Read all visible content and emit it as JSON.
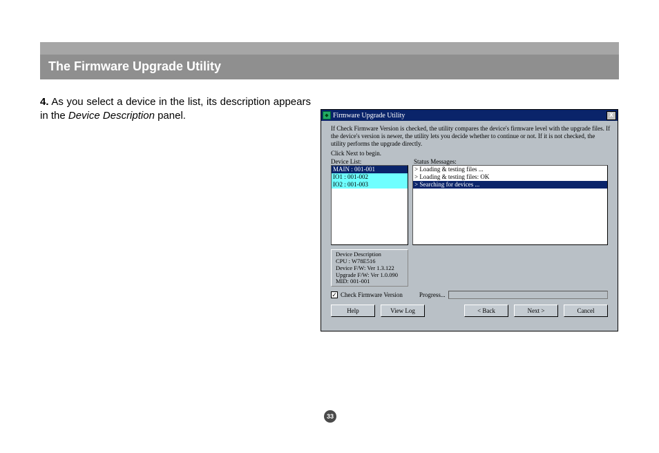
{
  "banner": {
    "title": "The Firmware Upgrade Utility"
  },
  "body": {
    "step_num": "4.",
    "text_a": " As you select a device in the list, its descrip­tion appears in the ",
    "ital": "Device Description",
    "text_b": " panel."
  },
  "page_number": "33",
  "dialog": {
    "title": "Firmware Upgrade Utility",
    "close": "x",
    "instructions": "If Check Firmware Version is checked, the utility compares the device's firmware level with the upgrade files. If the device's version is newer, the utility lets you decide whether to continue or not. If it is not checked, the utility performs the upgrade directly.",
    "click_next": "Click Next to begin.",
    "device_list_label": "Device List:",
    "status_label": "Status Messages:",
    "device_list": {
      "i0": "MAIN : 001-001",
      "i1": "IO1 : 001-002",
      "i2": "IO2 : 001-003"
    },
    "status": {
      "s0": "> Loading & testing files ...",
      "s1": "> Loading & testing files: OK",
      "s2": "> Searching for devices ..."
    },
    "desc": {
      "l0": "Device Description",
      "l1": "CPU : W78E516",
      "l2": "Device F/W: Ver 1.3.122",
      "l3": "Upgrade F/W: Ver 1.0.090",
      "l4": "MID: 001-001"
    },
    "check_label": "Check Firmware Version",
    "check_mark": "✓",
    "progress_label": "Progress...",
    "buttons": {
      "help": "Help",
      "viewlog": "View Log",
      "back": "< Back",
      "next": "Next >",
      "cancel": "Cancel"
    }
  }
}
